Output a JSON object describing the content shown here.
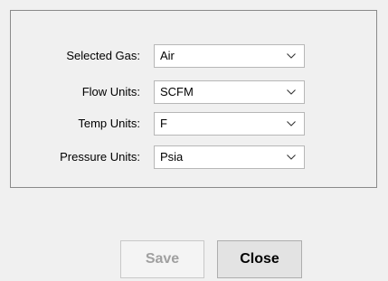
{
  "settings": {
    "rows": [
      {
        "label": "Selected Gas:",
        "value": "Air"
      },
      {
        "label": "Flow Units:",
        "value": "SCFM"
      },
      {
        "label": "Temp Units:",
        "value": "F"
      },
      {
        "label": "Pressure Units:",
        "value": "Psia"
      }
    ]
  },
  "buttons": {
    "save_label": "Save",
    "close_label": "Close"
  },
  "icons": {
    "dropdown": "chevron-down-icon"
  },
  "colors": {
    "background": "#f0f0f0",
    "disabled_text": "#a0a0a0",
    "border": "#8a8a8a"
  }
}
